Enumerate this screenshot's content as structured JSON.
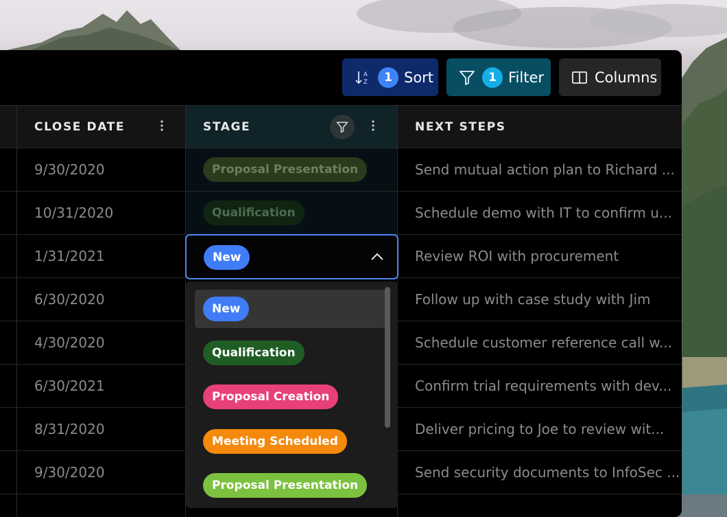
{
  "toolbar": {
    "sort": {
      "count": "1",
      "label": "Sort"
    },
    "filter": {
      "count": "1",
      "label": "Filter"
    },
    "columns": {
      "label": "Columns"
    }
  },
  "columns": {
    "close_date": "CLOSE DATE",
    "stage": "STAGE",
    "next_steps": "NEXT STEPS"
  },
  "rows": [
    {
      "close_date": "9/30/2020",
      "stage": "Proposal Presentation",
      "next_steps": "Send mutual action plan to Richard ..."
    },
    {
      "close_date": "10/31/2020",
      "stage": "Qualification",
      "next_steps": "Schedule demo with IT to confirm u..."
    },
    {
      "close_date": "1/31/2021",
      "stage": "New",
      "next_steps": "Review ROI with procurement"
    },
    {
      "close_date": "6/30/2020",
      "stage": "",
      "next_steps": "Follow up with case study with Jim"
    },
    {
      "close_date": "4/30/2020",
      "stage": "",
      "next_steps": "Schedule customer reference call w..."
    },
    {
      "close_date": "6/30/2021",
      "stage": "",
      "next_steps": "Confirm trial requirements with dev..."
    },
    {
      "close_date": "8/31/2020",
      "stage": "",
      "next_steps": "Deliver pricing to Joe to review wit..."
    },
    {
      "close_date": "9/30/2020",
      "stage": "",
      "next_steps": "Send security documents to InfoSec ..."
    }
  ],
  "stage_dropdown": {
    "selected": "New",
    "options": [
      "New",
      "Qualification",
      "Proposal Creation",
      "Meeting Scheduled",
      "Proposal Presentation"
    ]
  },
  "colors": {
    "new": "#3f7cf6",
    "qualification": "#1f5d24",
    "proposal_creation": "#e8407a",
    "meeting_scheduled": "#f5890c",
    "proposal_presentation": "#7cc13f",
    "focus_border": "#4f86f5"
  },
  "icons": {
    "sort": "sort-az-icon",
    "filter": "funnel-icon",
    "columns": "columns-icon",
    "menu": "kebab-menu-icon",
    "chevron": "chevron-up-icon"
  }
}
